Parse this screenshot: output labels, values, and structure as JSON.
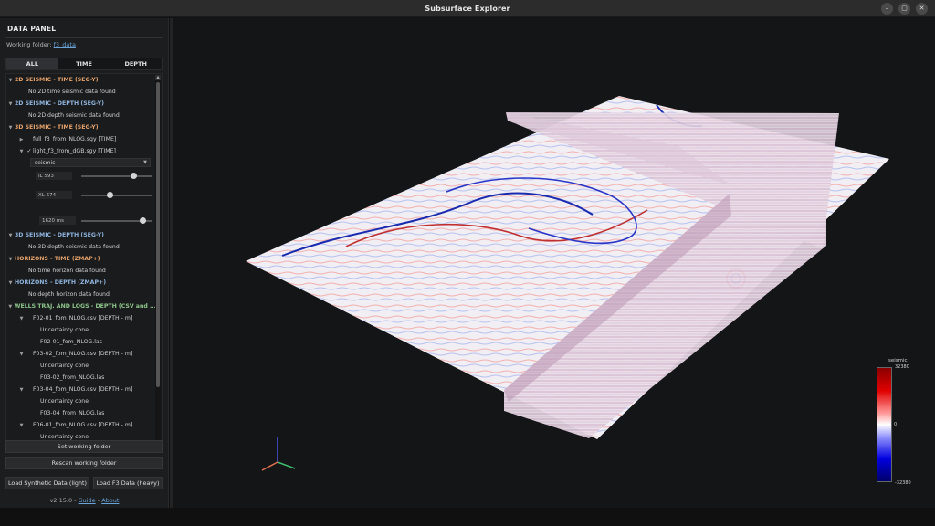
{
  "window": {
    "title": "Subsurface Explorer"
  },
  "panel": {
    "title": "DATA PANEL",
    "working_folder_label": "Working folder:",
    "working_folder_value": "f3_data",
    "tabs": [
      "ALL",
      "TIME",
      "DEPTH"
    ],
    "active_tab": "ALL",
    "tree": {
      "sec_2d_time": "2D SEISMIC - TIME (SEG-Y)",
      "sec_2d_time_empty": "No 2D time seismic data found",
      "sec_2d_depth": "2D SEISMIC - DEPTH (SEG-Y)",
      "sec_2d_depth_empty": "No 2D depth seismic data found",
      "sec_3d_time": "3D SEISMIC - TIME (SEG-Y)",
      "file_full": "full_f3_from_NLOG.sgy [TIME]",
      "file_light": "light_f3_from_dGB.sgy [TIME]",
      "attribute": "seismic",
      "il_value": "IL 593",
      "xl_value": "XL 674",
      "time_value": "1620 ms",
      "il_fraction": 0.74,
      "xl_fraction": 0.4,
      "time_fraction": 0.86,
      "sec_3d_depth": "3D SEISMIC - DEPTH (SEG-Y)",
      "sec_3d_depth_empty": "No 3D depth seismic data found",
      "sec_hor_time": "HORIZONS - TIME (ZMAP+)",
      "sec_hor_time_empty": "No time horizon data found",
      "sec_hor_depth": "HORIZONS - DEPTH (ZMAP+)",
      "sec_hor_depth_empty": "No depth horizon data found",
      "sec_wells": "WELLS TRAJ. AND LOGS - DEPTH (CSV and ...",
      "well1": "F02-01_fom_NLOG.csv [DEPTH - m]",
      "well1_cone": "Uncertainty cone",
      "well1_las": "F02-01_fom_NLOG.las",
      "well2": "F03-02_fom_NLOG.csv [DEPTH - m]",
      "well2_cone": "Uncertainty cone",
      "well2_las": "F03-02_from_NLOG.las",
      "well3": "F03-04_fom_NLOG.csv [DEPTH - m]",
      "well3_cone": "Uncertainty cone",
      "well3_las": "F03-04_from_NLOG.las",
      "well4": "F06-01_fom_NLOG.csv [DEPTH - m]",
      "well4_cone": "Uncertainty cone"
    },
    "buttons": {
      "set_folder": "Set working folder",
      "rescan_folder": "Rescan working folder",
      "load_synthetic": "Load Synthetic Data (light)",
      "load_f3": "Load F3 Data (heavy)"
    },
    "footer": {
      "version": "v2.15.0 -",
      "guide": "Guide",
      "sep": "-",
      "about": "About"
    }
  },
  "colorbar": {
    "title": "seismic",
    "max": "32380",
    "mid": "0",
    "min": "-32380"
  },
  "colors": {
    "accent_link": "#6aa3d8",
    "section_orange": "#e3a06a",
    "section_blue": "#8fb4de",
    "section_green": "#8dc48b"
  }
}
